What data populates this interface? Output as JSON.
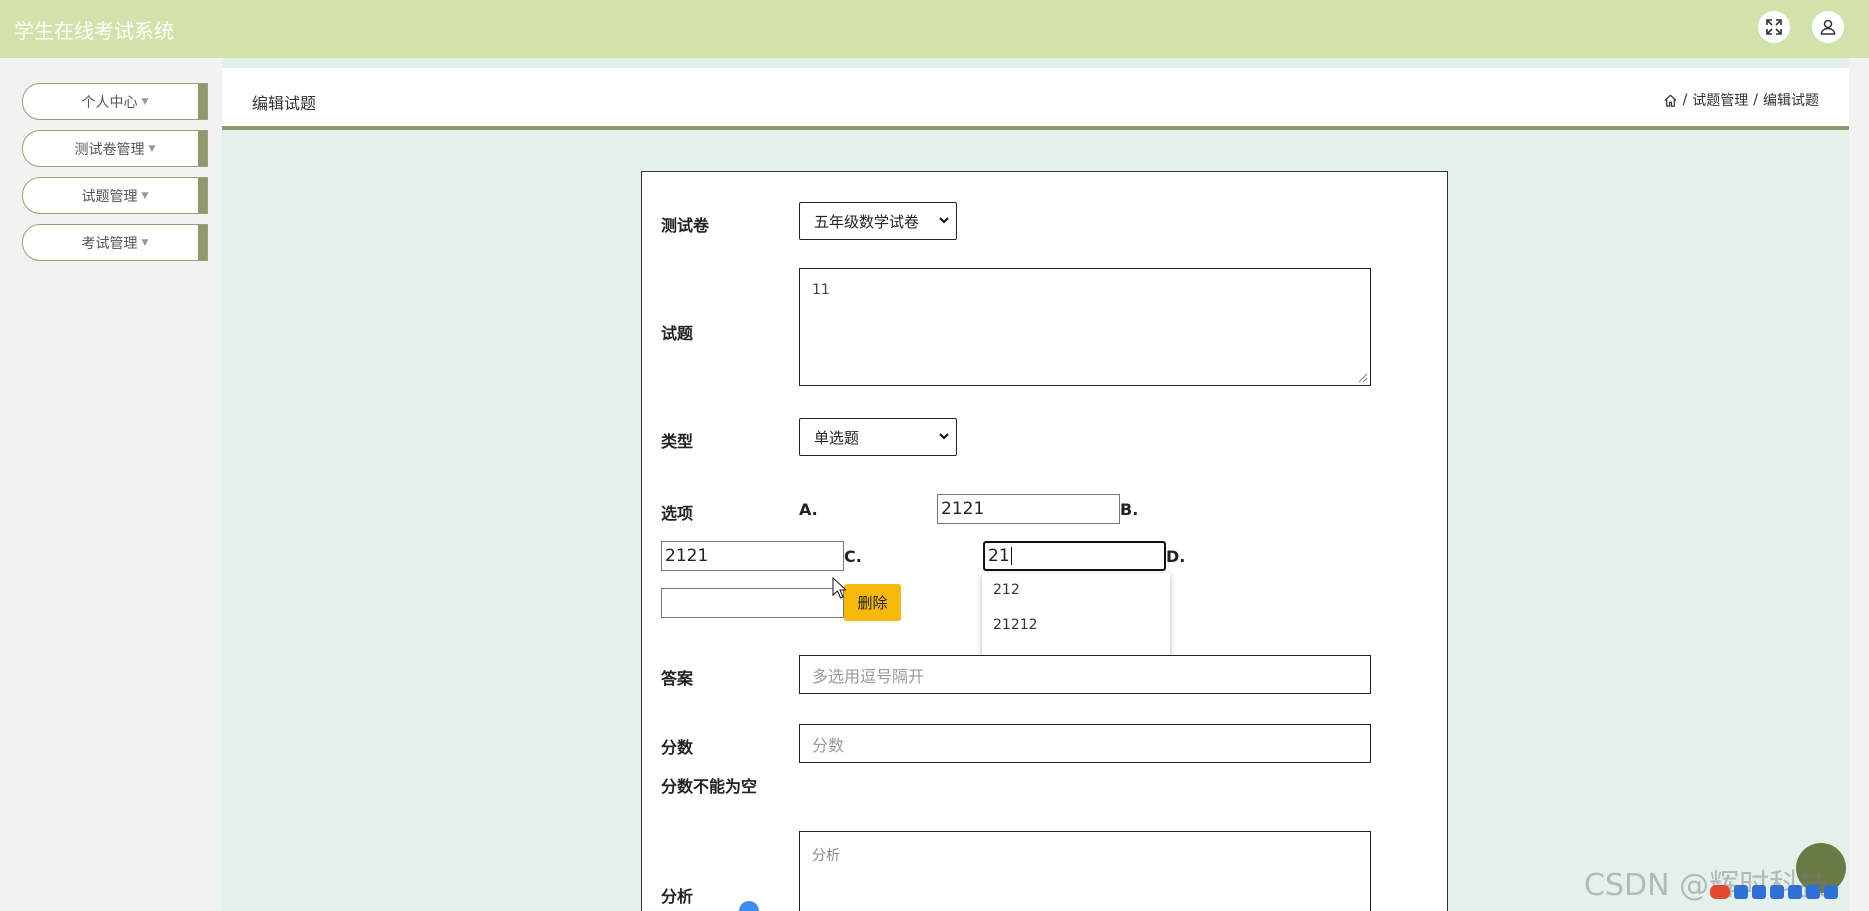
{
  "app": {
    "title": "学生在线考试系统"
  },
  "topbar": {
    "fullscreen_icon": "expand-icon",
    "user_icon": "user-icon"
  },
  "sidebar": {
    "items": [
      {
        "label": "个人中心"
      },
      {
        "label": "测试卷管理"
      },
      {
        "label": "试题管理"
      },
      {
        "label": "考试管理"
      }
    ]
  },
  "header": {
    "title": "编辑试题",
    "breadcrumb": {
      "sep1": "/",
      "item1": "试题管理",
      "sep2": "/",
      "item2": "编辑试题"
    }
  },
  "form": {
    "paper": {
      "label": "测试卷",
      "value": "五年级数学试卷"
    },
    "question": {
      "label": "试题",
      "value": "11"
    },
    "type": {
      "label": "类型",
      "value": "单选题"
    },
    "options": {
      "label": "选项",
      "a_letter": "A.",
      "b_letter": "B.",
      "c_letter": "C.",
      "d_letter": "D.",
      "a_value": "2121",
      "b_value": "2121",
      "c_value": "21",
      "d_value": "",
      "delete_label": "删除",
      "autocomplete": [
        "212",
        "21212"
      ]
    },
    "answer": {
      "label": "答案",
      "placeholder": "多选用逗号隔开"
    },
    "score": {
      "label": "分数",
      "placeholder": "分数",
      "error": "分数不能为空"
    },
    "analysis": {
      "label": "分析",
      "placeholder": "分析"
    }
  },
  "watermark": "CSDN @辉时科技",
  "colors": {
    "topbar": "#d3e1aa",
    "accent": "#8f9a6b",
    "content_bg": "#e4f1ea",
    "delete_button": "#f5b80b"
  }
}
